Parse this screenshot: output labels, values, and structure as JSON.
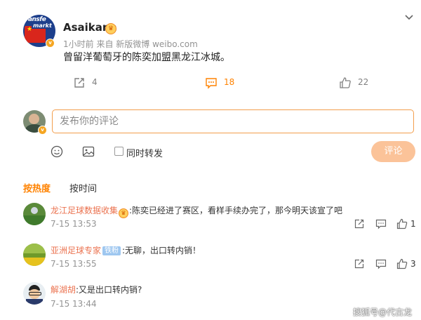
{
  "post": {
    "author": "Asaikana",
    "avatar_text_top": "ransfe",
    "avatar_text_bottom": "markt",
    "meta": "1小时前  来自 新版微博 weibo.com",
    "content": "曾留洋葡萄牙的陈奕加盟黑龙江冰城。",
    "repost_count": "4",
    "comment_count": "18",
    "like_count": "22"
  },
  "composer": {
    "placeholder": "发布你的评论",
    "repost_label": "同时转发",
    "submit_label": "评论"
  },
  "sort_tabs": {
    "hot": "按热度",
    "time": "按时间"
  },
  "comments": [
    {
      "user": "龙江足球数据收集",
      "text": ":陈奕已经进了赛区，看样手续办完了，那今明天该宣了吧",
      "time": "7-15 13:53",
      "like_count": "1"
    },
    {
      "user": "亚洲足球专家",
      "tag": "铁粉",
      "text": ":无聊，出口转内销！",
      "time": "7-15 13:55",
      "like_count": "3"
    },
    {
      "user": "解湖胡",
      "text": ":又是出口转内销?",
      "time": "7-15 13:44",
      "like_count": ""
    }
  ],
  "watermark": "搜狐号@代古龙",
  "colors": {
    "accent": "#ff8200",
    "username": "#eb7350",
    "comment_highlight": "#f39e4c",
    "submit_disabled": "#fbc399"
  }
}
